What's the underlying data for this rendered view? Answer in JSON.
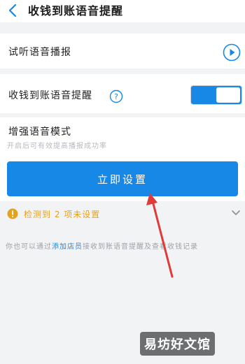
{
  "header": {
    "title": "收钱到账语音提醒",
    "back_icon": "chevron-left-icon"
  },
  "rows": {
    "listen_label": "试听语音播报",
    "listen_icon": "play-circle-icon",
    "notify_label": "收钱到账语音提醒",
    "notify_help_icon": "question-circle-icon",
    "notify_toggle_on": true,
    "enhance_label": "增强语音模式",
    "enhance_subtext": "开启后可有效提高播报成功率"
  },
  "primary_button": {
    "label": "立即设置"
  },
  "warning": {
    "text": "检测到 2 项未设置",
    "icon": "warning-icon",
    "color": "#e7a21b"
  },
  "footer": {
    "prefix": "你也可以通过",
    "link": "添加店员",
    "suffix": "接收到账语音提醒及查看收钱记录"
  },
  "watermark": {
    "text": "易坊好文馆"
  },
  "colors": {
    "accent": "#1788e5",
    "arrow": "#e03a3a"
  }
}
